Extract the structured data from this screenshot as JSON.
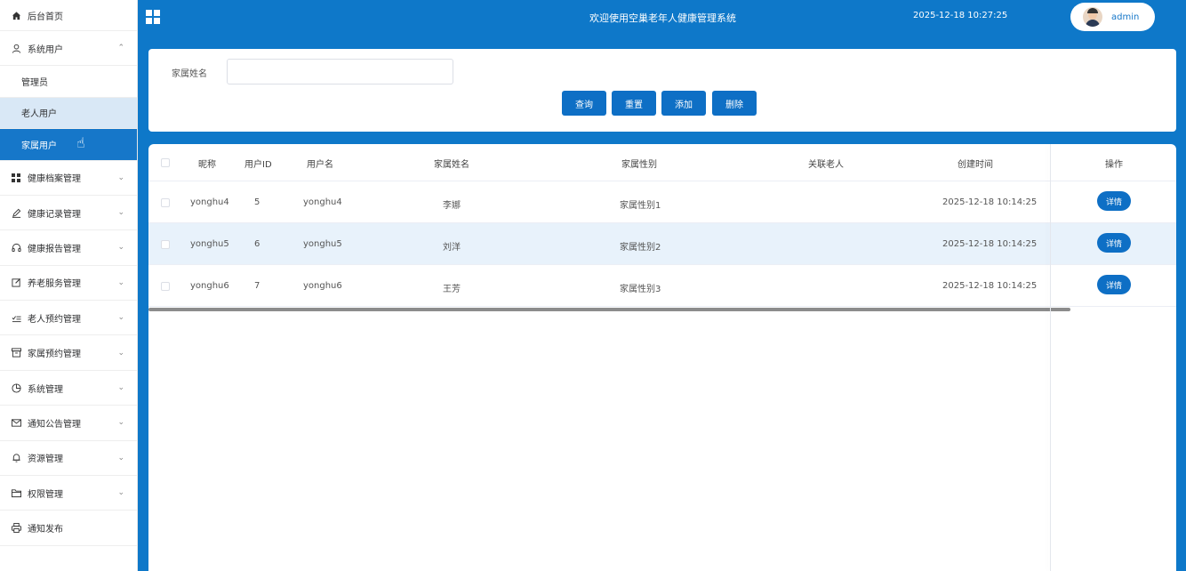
{
  "sidebar": {
    "home": "后台首页",
    "system_users": "系统用户",
    "sub_items": [
      "管理员",
      "老人用户",
      "家属用户"
    ],
    "menus": [
      {
        "label": "健康档案管理",
        "icon": "grid-icon"
      },
      {
        "label": "健康记录管理",
        "icon": "pen-icon"
      },
      {
        "label": "健康报告管理",
        "icon": "headphones-icon"
      },
      {
        "label": "养老服务管理",
        "icon": "edit-icon"
      },
      {
        "label": "老人预约管理",
        "icon": "list-check-icon"
      },
      {
        "label": "家属预约管理",
        "icon": "box-icon"
      },
      {
        "label": "系统管理",
        "icon": "pie-icon"
      },
      {
        "label": "通知公告管理",
        "icon": "mail-icon"
      },
      {
        "label": "资源管理",
        "icon": "bell-icon"
      },
      {
        "label": "权限管理",
        "icon": "folder-icon"
      },
      {
        "label": "通知发布",
        "icon": "printer-icon"
      }
    ]
  },
  "header": {
    "title": "欢迎使用空巢老年人健康管理系统",
    "datetime": "2025-12-18 10:27:25",
    "username": "admin"
  },
  "search": {
    "label": "家属姓名",
    "value": "",
    "placeholder": "",
    "buttons": [
      "查询",
      "重置",
      "添加",
      "删除"
    ]
  },
  "table": {
    "columns": [
      "昵称",
      "用户ID",
      "用户名",
      "家属姓名",
      "家属性别",
      "关联老人",
      "创建时间",
      "操作"
    ],
    "rows": [
      {
        "nickname": "yonghu4",
        "id": "5",
        "username": "yonghu4",
        "name": "李娜",
        "gender": "家属性别1",
        "elder": "",
        "created": "2025-12-18 10:14:25"
      },
      {
        "nickname": "yonghu5",
        "id": "6",
        "username": "yonghu5",
        "name": "刘洋",
        "gender": "家属性别2",
        "elder": "",
        "created": "2025-12-18 10:14:25"
      },
      {
        "nickname": "yonghu6",
        "id": "7",
        "username": "yonghu6",
        "name": "王芳",
        "gender": "家属性别3",
        "elder": "",
        "created": "2025-12-18 10:14:25"
      }
    ],
    "detail_label": "详情"
  },
  "colors": {
    "primary": "#0e78c9",
    "button": "#0e6fc5",
    "active_menu": "#1677c9",
    "row_highlight": "#e8f2fb"
  }
}
